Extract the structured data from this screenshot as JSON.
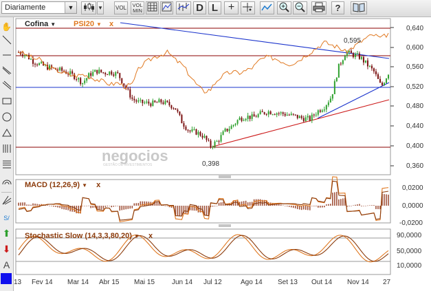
{
  "toolbar": {
    "period_select": "Diariamente",
    "vol_label": "VOL",
    "volmin_label": "VOL MIN",
    "d_label": "D",
    "l_label": "L",
    "help_label": "?"
  },
  "main_panel": {
    "symbol_select": "Cofina",
    "compare_label": "PSI20",
    "remove_label": "x",
    "watermark": "negocios",
    "watermark_sub": "GESTÃO DE INVESTIMENTOS",
    "annotation_high": "0,595",
    "annotation_low": "0,398",
    "y_ticks": [
      "0,640",
      "0,600",
      "0,560",
      "0,520",
      "0,480",
      "0,440",
      "0,400",
      "0,360"
    ]
  },
  "macd_panel": {
    "label": "MACD (12,26,9)",
    "remove_label": "x",
    "y_ticks": [
      "0,0200",
      "0,0000",
      "-0,0200"
    ]
  },
  "stoch_panel": {
    "label": "Stochastic Slow (14,3,3,80,20)",
    "remove_label": "x",
    "y_ticks": [
      "90,0000",
      "50,0000",
      "10,0000"
    ]
  },
  "x_axis": {
    "labels": [
      "13",
      "Fev 14",
      "Mar 14",
      "Abr 15",
      "Mai 15",
      "Jun 14",
      "Jul 12",
      "Ago 14",
      "Set 13",
      "Out 14",
      "Nov 14",
      "27"
    ]
  },
  "colors": {
    "price_up": "#2fa12f",
    "price_down": "#7a1010",
    "psi20": "#e07820",
    "trend_blue": "#1a33cc",
    "trend_red": "#cc1a1a",
    "level_line": "#8b0000"
  },
  "chart_data": {
    "type": "line",
    "title": "",
    "xlabel": "",
    "ylabel": "",
    "ylim": [
      0.34,
      0.655
    ],
    "series": [
      {
        "name": "Cofina",
        "values": [
          0.59,
          0.585,
          0.572,
          0.565,
          0.56,
          0.556,
          0.553,
          0.548,
          0.54,
          0.528,
          0.545,
          0.552,
          0.548,
          0.55,
          0.545,
          0.52,
          0.495,
          0.488,
          0.487,
          0.486,
          0.49,
          0.485,
          0.478,
          0.448,
          0.43,
          0.428,
          0.42,
          0.4,
          0.41,
          0.43,
          0.44,
          0.455,
          0.46,
          0.458,
          0.465,
          0.47,
          0.468,
          0.466,
          0.463,
          0.46,
          0.456,
          0.455,
          0.47,
          0.48,
          0.5,
          0.56,
          0.59,
          0.585,
          0.58,
          0.565,
          0.55,
          0.52,
          0.548
        ]
      },
      {
        "name": "PSI20",
        "values": [
          0.592,
          0.585,
          0.578,
          0.575,
          0.56,
          0.555,
          0.55,
          0.545,
          0.542,
          0.545,
          0.54,
          0.535,
          0.53,
          0.525,
          0.528,
          0.52,
          0.525,
          0.56,
          0.57,
          0.58,
          0.585,
          0.59,
          0.575,
          0.565,
          0.545,
          0.525,
          0.51,
          0.515,
          0.535,
          0.545,
          0.55,
          0.548,
          0.553,
          0.56,
          0.575,
          0.58,
          0.578,
          0.572,
          0.566,
          0.57,
          0.58,
          0.59,
          0.6,
          0.61,
          0.605,
          0.6,
          0.59,
          0.6,
          0.61,
          0.62,
          0.625,
          0.618,
          0.628
        ]
      }
    ]
  }
}
